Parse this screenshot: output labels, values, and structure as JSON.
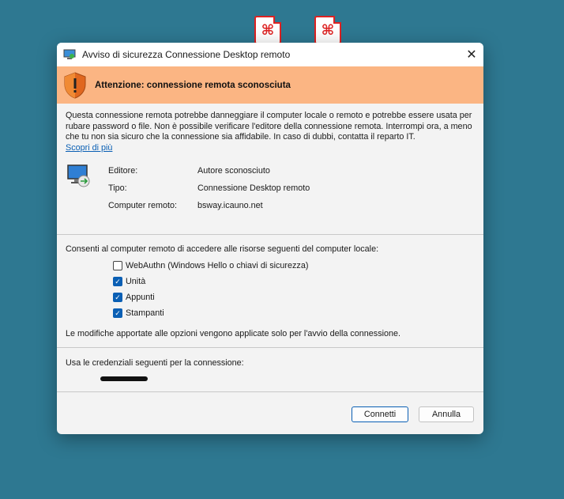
{
  "dialog": {
    "title": "Avviso di sicurezza Connessione Desktop remoto",
    "banner": "Attenzione: connessione remota sconosciuta",
    "warning_text": "Questa connessione remota potrebbe danneggiare il computer locale o remoto e potrebbe essere usata per rubare password o file. Non è possibile verificare l'editore della connessione remota. Interrompi ora, a meno che tu non sia sicuro che la connessione sia affidabile. In caso di dubbi, contatta il reparto IT.",
    "learn_more": "Scopri di più",
    "info": [
      {
        "label": "Editore:",
        "value": "Autore sconosciuto"
      },
      {
        "label": "Tipo:",
        "value": "Connessione Desktop remoto"
      },
      {
        "label": "Computer remoto:",
        "value": "bsway.icauno.net"
      }
    ],
    "permissions_heading": "Consenti al computer remoto di accedere alle risorse seguenti del computer locale:",
    "checkboxes": [
      {
        "label": "WebAuthn (Windows Hello o chiavi di sicurezza)",
        "checked": false
      },
      {
        "label": "Unità",
        "checked": true
      },
      {
        "label": "Appunti",
        "checked": true
      },
      {
        "label": "Stampanti",
        "checked": true
      }
    ],
    "note": "Le modifiche apportate alle opzioni vengono applicate solo per l'avvio della connessione.",
    "credentials_heading": "Usa le credenziali seguenti per la connessione:",
    "connect_label": "Connetti",
    "cancel_label": "Annulla",
    "close_glyph": "✕"
  },
  "desktop": {
    "icons": [
      "pdf-file-icon",
      "pdf-file-icon"
    ]
  },
  "colors": {
    "banner": "#fbb583",
    "accent": "#0a5fb4",
    "desktop": "#2e7891"
  }
}
